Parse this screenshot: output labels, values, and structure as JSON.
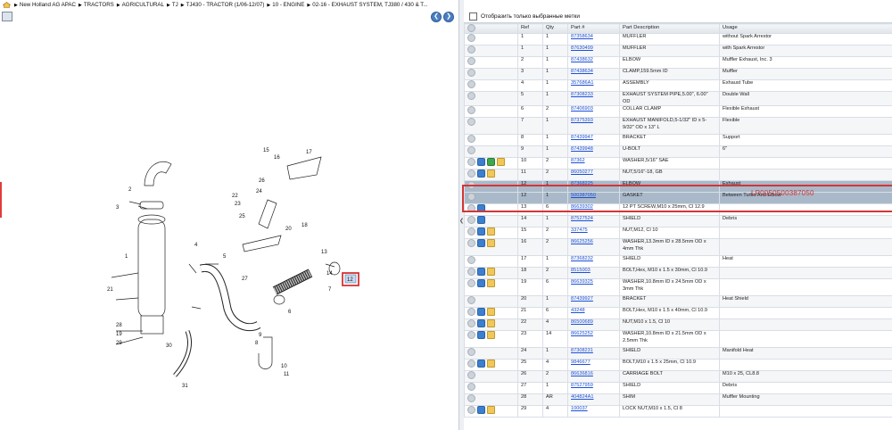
{
  "breadcrumb": [
    "New Holland AG APAC",
    "TRACTORS",
    "AGRICULTURAL",
    "TJ",
    "TJ430 - TRACTOR (1/06-12/07)",
    "10 - ENGINE",
    "02-16 - EXHAUST SYSTEM, TJ380 / 430 & T..."
  ],
  "diagram": {
    "callouts": [
      "15",
      "16",
      "17",
      "2",
      "3",
      "26",
      "22",
      "23",
      "24",
      "25",
      "5",
      "1",
      "4",
      "21",
      "28",
      "19",
      "29",
      "30",
      "31",
      "27",
      "18",
      "9",
      "8",
      "10",
      "11",
      "6",
      "7",
      "13",
      "12",
      "20",
      "14"
    ],
    "highlighted_ref": "12"
  },
  "right": {
    "filter_label": "Отобразить только выбранные метки",
    "headers": [
      "",
      "Ref",
      "Qty",
      "Part #",
      "Part Description",
      "Usage"
    ],
    "rows": [
      {
        "icons": [],
        "ref": "1",
        "qty": "1",
        "part": "87358634",
        "desc": "MUFFLER",
        "usage": "without Spark Arrestor"
      },
      {
        "icons": [],
        "ref": "1",
        "qty": "1",
        "part": "87630499",
        "desc": "MUFFLER",
        "usage": "with Spark Arrestor"
      },
      {
        "icons": [],
        "ref": "2",
        "qty": "1",
        "part": "87438632",
        "desc": "ELBOW",
        "usage": "Muffler Exhaust, Inc. 3"
      },
      {
        "icons": [],
        "ref": "3",
        "qty": "1",
        "part": "87438634",
        "desc": "CLAMP,159.5mm ID",
        "usage": "Muffler"
      },
      {
        "icons": [],
        "ref": "4",
        "qty": "1",
        "part": "357686A1",
        "desc": "ASSEMBLY",
        "usage": "Exhaust Tube"
      },
      {
        "icons": [],
        "ref": "5",
        "qty": "1",
        "part": "87308233",
        "desc": "EXHAUST SYSTEM PIPE,5.00\", 6.00\" OD",
        "usage": "Double Wall"
      },
      {
        "icons": [],
        "ref": "6",
        "qty": "2",
        "part": "87406903",
        "desc": "COLLAR CLAMP",
        "usage": "Flexible Exhaust"
      },
      {
        "icons": [],
        "ref": "7",
        "qty": "1",
        "part": "87375393",
        "desc": "EXHAUST MANIFOLD,5-1/32\" ID x 5-9/32\" OD x 13\" L",
        "usage": "Flexible",
        "tall": true
      },
      {
        "icons": [],
        "ref": "8",
        "qty": "1",
        "part": "87439947",
        "desc": "BRACKET",
        "usage": "Support"
      },
      {
        "icons": [],
        "ref": "9",
        "qty": "1",
        "part": "87439948",
        "desc": "U-BOLT",
        "usage": "6\""
      },
      {
        "icons": [
          "arr",
          "grn",
          "pkg"
        ],
        "ref": "10",
        "qty": "2",
        "part": "87362",
        "desc": "WASHER,5/16\" SAE",
        "usage": ""
      },
      {
        "icons": [
          "arr",
          "pkg"
        ],
        "ref": "11",
        "qty": "2",
        "part": "86050277",
        "desc": "NUT,5/16\"-18, GB",
        "usage": ""
      },
      {
        "icons": [],
        "ref": "12",
        "qty": "1",
        "part": "87368225",
        "desc": "ELBOW",
        "usage": "Exhaust",
        "sel": true
      },
      {
        "icons": [],
        "ref": "12",
        "qty": "1",
        "part": "500387050",
        "desc": "GASKET",
        "usage": "Between Turbo And Elbow",
        "sel": true
      },
      {
        "icons": [
          "arr"
        ],
        "ref": "13",
        "qty": "6",
        "part": "86639302",
        "desc": "12 PT SCREW,M10 x 25mm, Cl 12.9",
        "usage": ""
      },
      {
        "icons": [
          "arr"
        ],
        "ref": "14",
        "qty": "1",
        "part": "87527524",
        "desc": "SHIELD",
        "usage": "Debris"
      },
      {
        "icons": [
          "arr",
          "pkg"
        ],
        "ref": "15",
        "qty": "2",
        "part": "337475",
        "desc": "NUT,M12, Cl 10",
        "usage": ""
      },
      {
        "icons": [
          "arr",
          "pkg"
        ],
        "ref": "16",
        "qty": "2",
        "part": "86625256",
        "desc": "WASHER,13.3mm ID x 28.5mm OD x 4mm Thk",
        "usage": "",
        "tall": true
      },
      {
        "icons": [],
        "ref": "17",
        "qty": "1",
        "part": "87368232",
        "desc": "SHIELD",
        "usage": "Heat"
      },
      {
        "icons": [
          "arr",
          "pkg"
        ],
        "ref": "18",
        "qty": "2",
        "part": "8515003",
        "desc": "BOLT,Hex, M10 x 1.5 x 30mm, Cl 10.9",
        "usage": ""
      },
      {
        "icons": [
          "arr",
          "pkg"
        ],
        "ref": "19",
        "qty": "6",
        "part": "86639325",
        "desc": "WASHER,10.8mm ID x 24.5mm OD x 3mm Thk",
        "usage": "",
        "tall": true
      },
      {
        "icons": [],
        "ref": "20",
        "qty": "1",
        "part": "87439927",
        "desc": "BRACKET",
        "usage": "Heat Shield"
      },
      {
        "icons": [
          "arr",
          "pkg"
        ],
        "ref": "21",
        "qty": "6",
        "part": "43248",
        "desc": "BOLT,Hex, M10 x 1.5 x 40mm, Cl 10.9",
        "usage": ""
      },
      {
        "icons": [
          "arr",
          "pkg"
        ],
        "ref": "22",
        "qty": "4",
        "part": "86500689",
        "desc": "NUT,M10 x 1.5, Cl 10",
        "usage": ""
      },
      {
        "icons": [
          "arr",
          "pkg"
        ],
        "ref": "23",
        "qty": "14",
        "part": "86625252",
        "desc": "WASHER,10.8mm ID x 21.5mm OD x 2.5mm Thk",
        "usage": "",
        "tall": true
      },
      {
        "icons": [],
        "ref": "24",
        "qty": "1",
        "part": "87308231",
        "desc": "SHIELD",
        "usage": "Manifold Heat"
      },
      {
        "icons": [
          "arr",
          "pkg"
        ],
        "ref": "25",
        "qty": "4",
        "part": "9846677",
        "desc": "BOLT,M10 x 1.5 x 25mm, Cl 10.9",
        "usage": ""
      },
      {
        "icons": [],
        "ref": "26",
        "qty": "2",
        "part": "86636816",
        "desc": "CARRIAGE BOLT",
        "usage": "M10 x 25, CL8.8"
      },
      {
        "icons": [],
        "ref": "27",
        "qty": "1",
        "part": "87527959",
        "desc": "SHIELD",
        "usage": "Debris"
      },
      {
        "icons": [],
        "ref": "28",
        "qty": "AR",
        "part": "404824A1",
        "desc": "SHIM",
        "usage": "Muffler Mounting"
      },
      {
        "icons": [
          "arr",
          "pkg"
        ],
        "ref": "29",
        "qty": "4",
        "part": "100037",
        "desc": "LOCK NUT,M10 x 1.5, Cl 8",
        "usage": ""
      }
    ],
    "overlay_text": "LP0050500387050"
  }
}
